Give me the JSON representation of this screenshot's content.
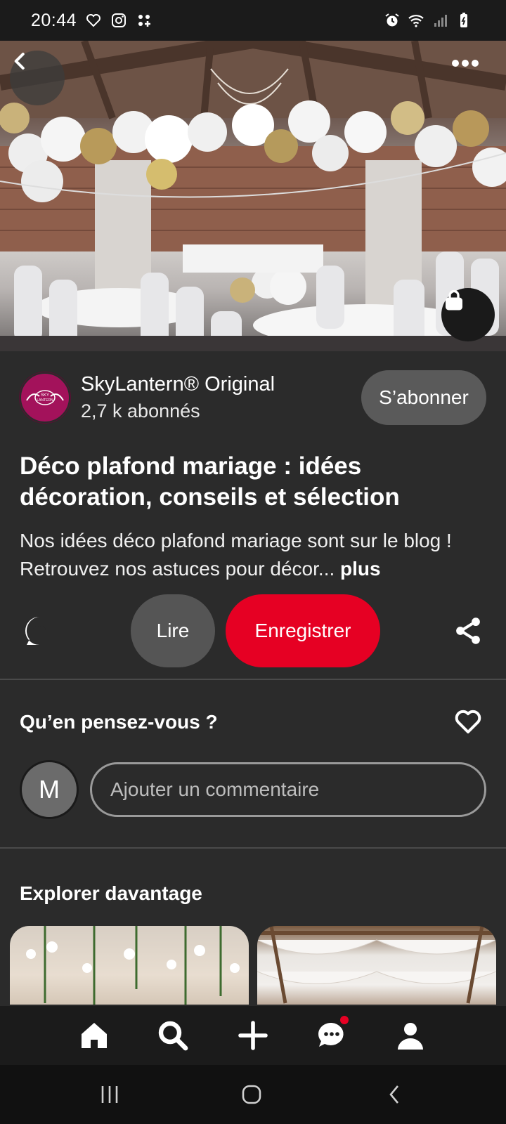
{
  "status_bar": {
    "time": "20:44"
  },
  "author": {
    "name": "SkyLantern® Original",
    "followers": "2,7 k abonnés",
    "avatar_text": "SKY LANTERN",
    "follow_label": "S’abonner",
    "brand_color": "#a3125b"
  },
  "pin": {
    "title": "Déco plafond mariage : idées décoration, conseils et sélection",
    "description": "Nos idées déco plafond mariage sont sur le blog ! Retrouvez nos astuces pour décor...",
    "more_label": "plus"
  },
  "actions": {
    "read_label": "Lire",
    "save_label": "Enregistrer",
    "save_color": "#e60023"
  },
  "comments": {
    "prompt": "Qu’en pensez-vous ?",
    "user_initial": "M",
    "placeholder": "Ajouter un commentaire"
  },
  "explore": {
    "title": "Explorer davantage"
  },
  "nav": {
    "items": [
      "home-icon",
      "search-icon",
      "plus-icon",
      "messages-icon",
      "profile-icon"
    ],
    "notification_dot_color": "#e60023"
  }
}
